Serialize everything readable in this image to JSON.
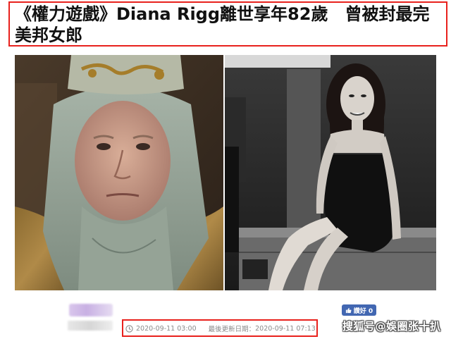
{
  "article": {
    "headline": "《權力遊戲》Diana Rigg離世享年82歲　曾被封最完美邦女郎",
    "published_time": "2020-09-11 03:00",
    "last_updated_label": "最後更新日期：",
    "last_updated_time": "2020-09-11 07:13"
  },
  "social": {
    "fb_like_label": "讚好 0"
  },
  "watermark": {
    "text": "搜狐号@娛圈张十扒"
  },
  "colors": {
    "highlight_box": "#e8211d",
    "fb_blue": "#4267b2",
    "meta_text": "#8a8a8a"
  },
  "icons": {
    "clock": "clock-icon",
    "thumb": "thumbs-up-icon"
  }
}
